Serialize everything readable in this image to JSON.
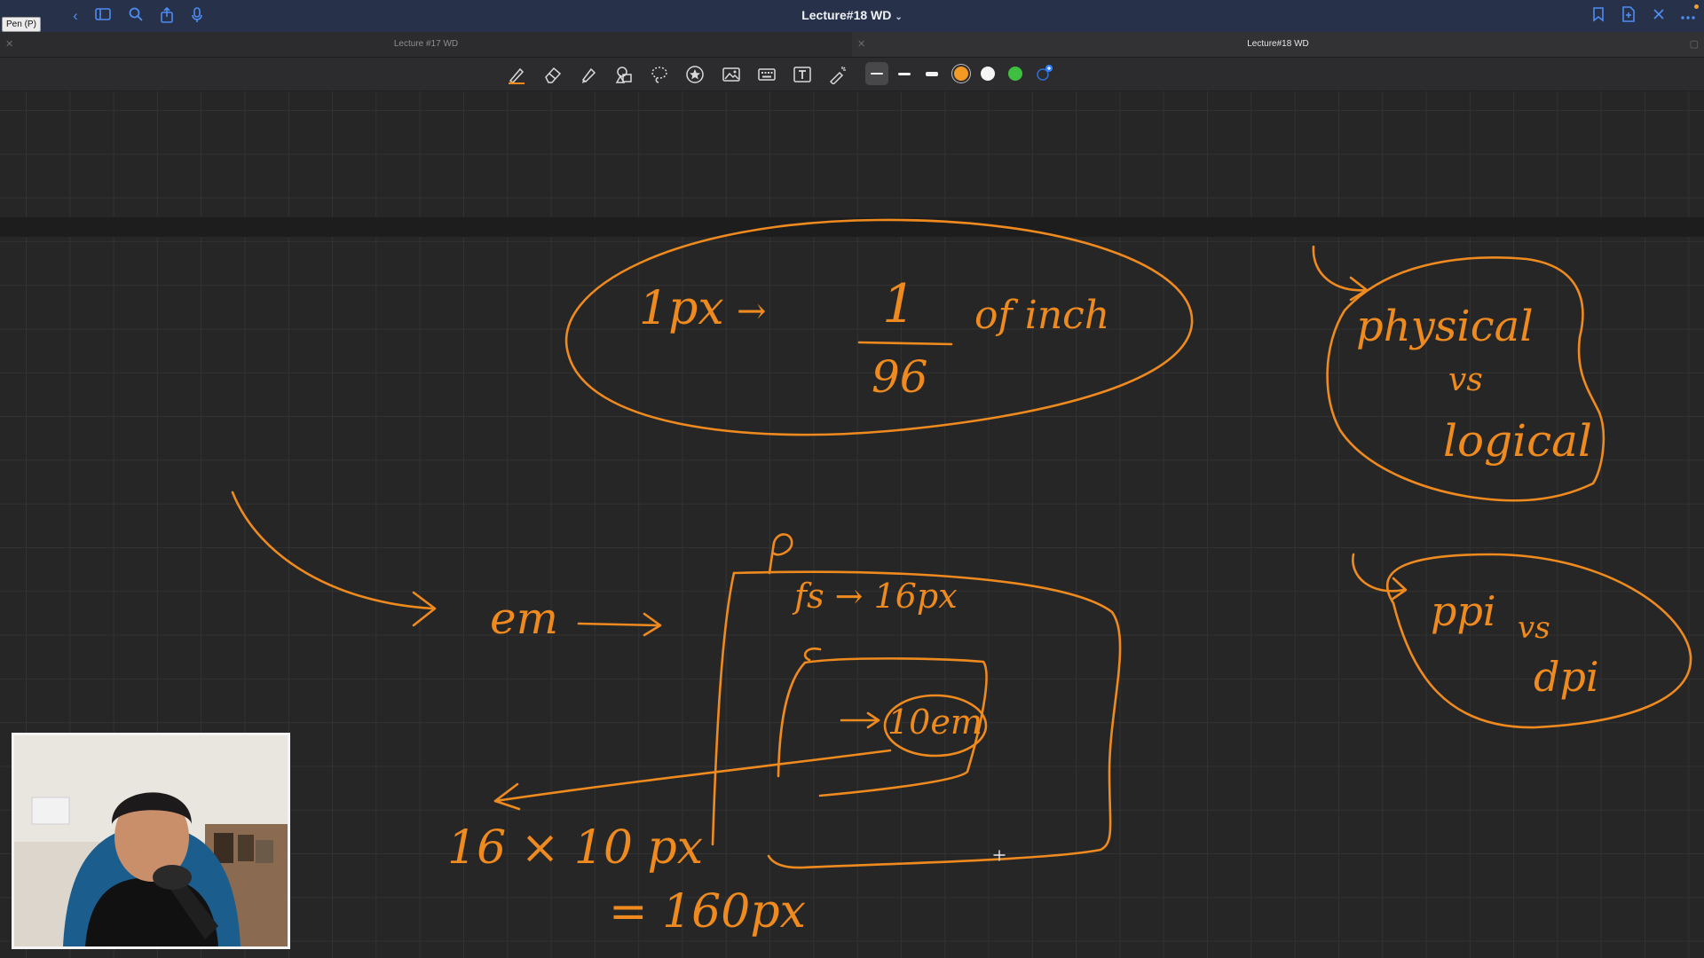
{
  "titlebar": {
    "tool_tooltip": "Pen (P)",
    "document_title": "Lecture#18 WD",
    "title_caret": "⌄"
  },
  "tabs": [
    {
      "label": "Lecture #17 WD",
      "active": false
    },
    {
      "label": "Lecture#18 WD",
      "active": true
    }
  ],
  "toolbar": {
    "tools": [
      "pen-icon",
      "eraser-icon",
      "highlighter-icon",
      "shapes-icon",
      "lasso-icon",
      "star-sticker-icon",
      "image-icon",
      "keyboard-icon",
      "text-box-icon",
      "laser-pointer-icon"
    ],
    "stroke_widths": [
      "thin",
      "medium",
      "thick"
    ],
    "selected_stroke": "thin",
    "colors": [
      "#f39a24",
      "#f5f5f5",
      "#3fbf3f"
    ],
    "selected_color": "#f39a24",
    "add_color_icon": "add-color-icon"
  },
  "notes": {
    "px_definition": {
      "lhs": "1px",
      "numerator": "1",
      "denominator": "96",
      "suffix": "of inch"
    },
    "em_label": "em",
    "fs_line": "fs → 16px",
    "c_label": "c",
    "inner_value": "10em",
    "calc_line": "16 × 10 px",
    "result_line": "= 160px",
    "p_label": "p",
    "physical": "physical",
    "vs_1": "vs",
    "logical": "logical",
    "ppi": "ppi",
    "vs_2": "vs",
    "dpi": "dpi"
  },
  "colors": {
    "ink": "#ef8a1f",
    "titlebar_bg": "#27324a",
    "accent_blue": "#4d8df2",
    "canvas_bg": "#262626"
  }
}
